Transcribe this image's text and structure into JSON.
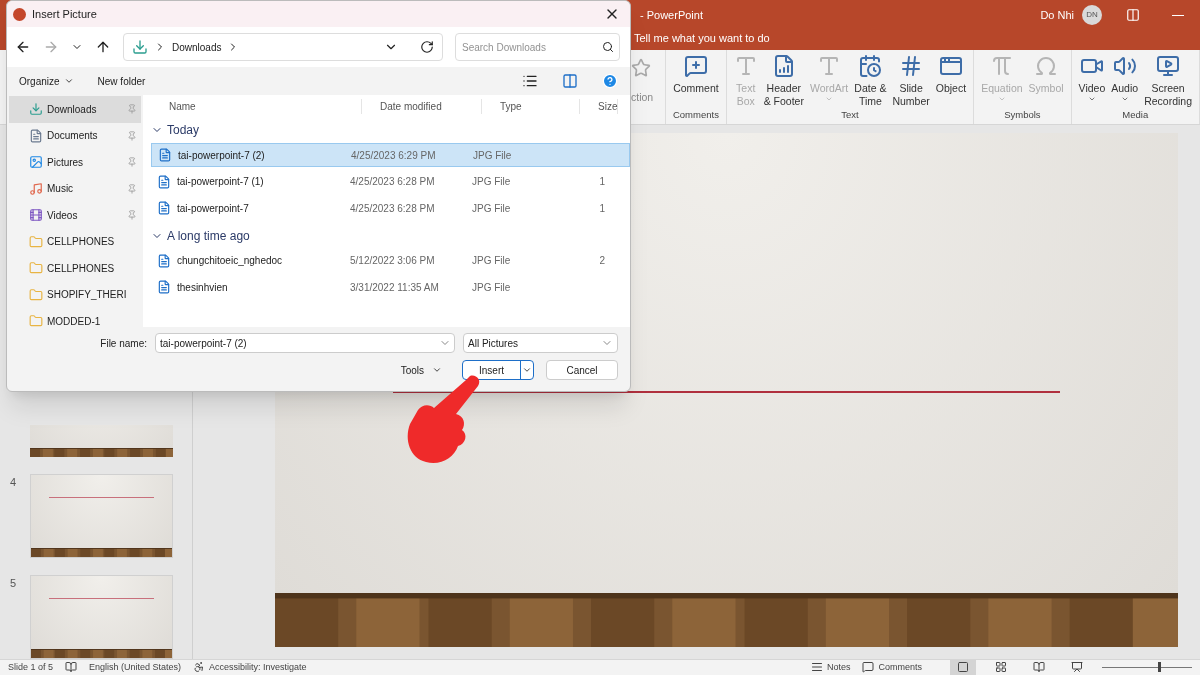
{
  "app": {
    "title": "-  PowerPoint",
    "user": "Do Nhi",
    "initials": "DN",
    "tell_me": "Tell me what you want to do"
  },
  "ribbon": {
    "partial_label": "ction",
    "groups": [
      {
        "name": "Comments",
        "items": [
          {
            "kind": "comment",
            "label": [
              "Comment"
            ],
            "disabled": false,
            "dropdown": false
          }
        ]
      },
      {
        "name": "Text",
        "items": [
          {
            "kind": "textbox",
            "label": [
              "Text",
              "Box"
            ],
            "disabled": true,
            "dropdown": false
          },
          {
            "kind": "header",
            "label": [
              "Header",
              "& Footer"
            ],
            "disabled": false,
            "dropdown": false
          },
          {
            "kind": "wordart",
            "label": [
              "WordArt"
            ],
            "disabled": true,
            "dropdown": true
          },
          {
            "kind": "datetime",
            "label": [
              "Date &",
              "Time"
            ],
            "disabled": false,
            "dropdown": false
          },
          {
            "kind": "slidenumber",
            "label": [
              "Slide",
              "Number"
            ],
            "disabled": false,
            "dropdown": false
          },
          {
            "kind": "object",
            "label": [
              "Object"
            ],
            "disabled": false,
            "dropdown": false
          }
        ]
      },
      {
        "name": "Symbols",
        "items": [
          {
            "kind": "equation",
            "label": [
              "Equation"
            ],
            "disabled": true,
            "dropdown": true
          },
          {
            "kind": "symbol",
            "label": [
              "Symbol"
            ],
            "disabled": true,
            "dropdown": false
          }
        ]
      },
      {
        "name": "Media",
        "items": [
          {
            "kind": "video",
            "label": [
              "Video"
            ],
            "disabled": false,
            "dropdown": true
          },
          {
            "kind": "audio",
            "label": [
              "Audio"
            ],
            "disabled": false,
            "dropdown": true
          },
          {
            "kind": "screen",
            "label": [
              "Screen",
              "Recording"
            ],
            "disabled": false,
            "dropdown": false
          }
        ]
      }
    ]
  },
  "slides": [
    {
      "number": "4"
    },
    {
      "number": "5"
    }
  ],
  "status_bar": {
    "slide": "Slide 1 of 5",
    "language": "English (United States)",
    "accessibility": "Accessibility: Investigate",
    "notes": "Notes",
    "comments": "Comments",
    "views": [
      {
        "kind": "normal",
        "selected": true
      },
      {
        "kind": "sorter",
        "selected": false
      },
      {
        "kind": "reading",
        "selected": false
      },
      {
        "kind": "show",
        "selected": false
      }
    ],
    "zoom": {
      "level": 0.62
    }
  },
  "dialog": {
    "title": "Insert Picture",
    "path": "Downloads",
    "search_placeholder": "Search Downloads",
    "organize": "Organize",
    "new_folder": "New folder",
    "sidebar": [
      {
        "kind": "downloads",
        "label": "Downloads",
        "pinned": true,
        "selected": true
      },
      {
        "kind": "documents",
        "label": "Documents",
        "pinned": true,
        "selected": false
      },
      {
        "kind": "pictures",
        "label": "Pictures",
        "pinned": true,
        "selected": false
      },
      {
        "kind": "music",
        "label": "Music",
        "pinned": true,
        "selected": false
      },
      {
        "kind": "videos",
        "label": "Videos",
        "pinned": true,
        "selected": false
      },
      {
        "kind": "folder",
        "label": "CELLPHONES",
        "pinned": false,
        "selected": false
      },
      {
        "kind": "folder",
        "label": "CELLPHONES",
        "pinned": false,
        "selected": false
      },
      {
        "kind": "folder",
        "label": "SHOPIFY_THERI",
        "pinned": false,
        "selected": false
      },
      {
        "kind": "folder",
        "label": "MODDED-1",
        "pinned": false,
        "selected": false
      }
    ],
    "columns": [
      "Name",
      "Date modified",
      "Type",
      "Size"
    ],
    "groups": [
      {
        "label": "Today",
        "expanded": true,
        "files": [
          {
            "name": "tai-powerpoint-7 (2)",
            "date": "4/25/2023 6:29 PM",
            "type": "JPG File",
            "selected": true
          },
          {
            "name": "tai-powerpoint-7 (1)",
            "date": "4/25/2023 6:28 PM",
            "type": "JPG File",
            "size": "1",
            "selected": false
          },
          {
            "name": "tai-powerpoint-7",
            "date": "4/25/2023 6:28 PM",
            "type": "JPG File",
            "size": "1",
            "selected": false
          }
        ]
      },
      {
        "label": "A long time ago",
        "expanded": true,
        "files": [
          {
            "name": "chungchitoeic_nghedoc",
            "date": "5/12/2022 3:06 PM",
            "type": "JPG File",
            "size": "2",
            "selected": false
          },
          {
            "name": "thesinhvien",
            "date": "3/31/2022 11:35 AM",
            "type": "JPG File",
            "selected": false
          }
        ]
      }
    ],
    "file_name_label": "File name:",
    "file_name": "tai-powerpoint-7 (2)",
    "filter": "All Pictures",
    "tools": "Tools",
    "insert": "Insert",
    "cancel": "Cancel"
  }
}
